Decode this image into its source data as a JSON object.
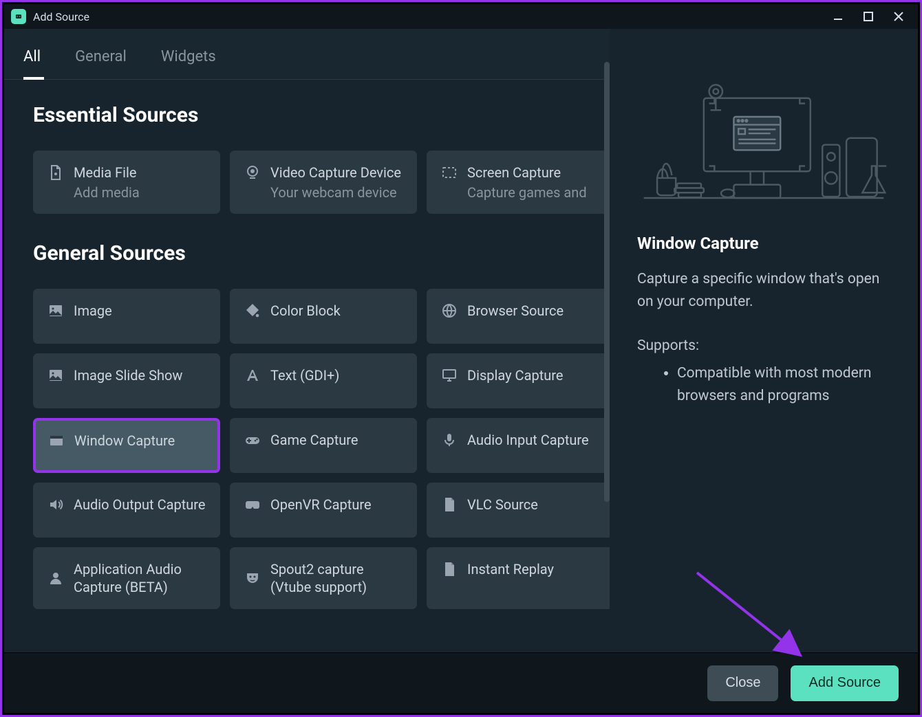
{
  "window": {
    "title": "Add Source"
  },
  "tabs": [
    {
      "label": "All",
      "active": true
    },
    {
      "label": "General",
      "active": false
    },
    {
      "label": "Widgets",
      "active": false
    }
  ],
  "sections": {
    "essential": {
      "title": "Essential Sources",
      "items": [
        {
          "name": "media-file",
          "icon": "file-icon",
          "label": "Media File",
          "sub": "Add media"
        },
        {
          "name": "video-capture",
          "icon": "webcam-icon",
          "label": "Video Capture Device",
          "sub": "Your webcam device"
        },
        {
          "name": "screen-capture",
          "icon": "dashed-rect-icon",
          "label": "Screen Capture",
          "sub": "Capture games and"
        }
      ]
    },
    "general": {
      "title": "General Sources",
      "items": [
        {
          "name": "image",
          "icon": "image-icon",
          "label": "Image"
        },
        {
          "name": "color-block",
          "icon": "paint-icon",
          "label": "Color Block"
        },
        {
          "name": "browser-source",
          "icon": "globe-icon",
          "label": "Browser Source"
        },
        {
          "name": "image-slideshow",
          "icon": "image-icon",
          "label": "Image Slide Show"
        },
        {
          "name": "text-gdi",
          "icon": "font-icon",
          "label": "Text (GDI+)"
        },
        {
          "name": "display-capture",
          "icon": "monitor-icon",
          "label": "Display Capture"
        },
        {
          "name": "window-capture",
          "icon": "window-icon",
          "label": "Window Capture",
          "selected": true
        },
        {
          "name": "game-capture",
          "icon": "gamepad-icon",
          "label": "Game Capture"
        },
        {
          "name": "audio-input",
          "icon": "mic-icon",
          "label": "Audio Input Capture"
        },
        {
          "name": "audio-output",
          "icon": "speaker-icon",
          "label": "Audio Output Capture"
        },
        {
          "name": "openvr-capture",
          "icon": "vr-icon",
          "label": "OpenVR Capture"
        },
        {
          "name": "vlc-source",
          "icon": "doc-icon",
          "label": "VLC Source"
        },
        {
          "name": "app-audio",
          "icon": "person-icon",
          "label": "Application Audio Capture (BETA)"
        },
        {
          "name": "spout2",
          "icon": "mask-icon",
          "label": "Spout2 capture (Vtube support)"
        },
        {
          "name": "instant-replay",
          "icon": "doc-icon",
          "label": "Instant Replay"
        }
      ]
    }
  },
  "detail": {
    "title": "Window Capture",
    "description": "Capture a specific window that's open on your computer.",
    "supports_label": "Supports:",
    "supports": [
      "Compatible with most modern browsers and programs"
    ]
  },
  "footer": {
    "close": "Close",
    "add_source": "Add Source"
  },
  "colors": {
    "accent": "#5ce1c0",
    "highlight": "#9333ea"
  }
}
